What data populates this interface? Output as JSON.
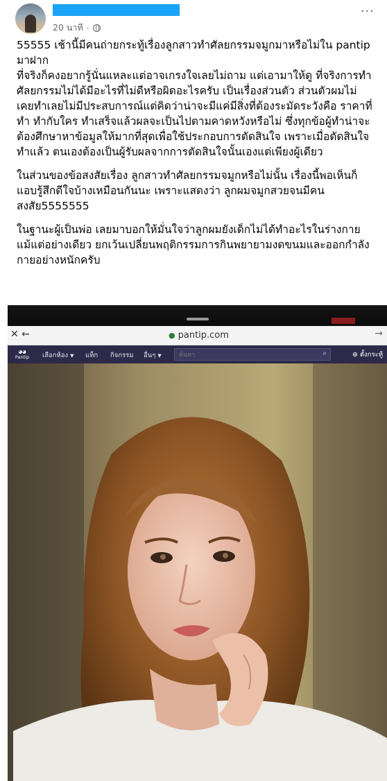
{
  "post": {
    "timestamp": "20 นาที",
    "paragraphs": [
      "55555 เช้านี้มีคนถ่ายกระทู้เรื่องลูกสาวทำศัลยกรรมจมูกมาหรือไม่ใน pantip มาฝาก\nที่จริงก็คงอยากรู้นั่นแหละแต่อาจเกรงใจเลยไม่ถาม แต่เอามาให้ดู ที่จริงการทำศัลยกรรมไม่ได้มีอะไรที่ไม่ดีหรือผิดอะไรครับ เป็นเรื่องส่วนตัว ส่วนตัวผมไม่เคยทำเลยไม่มีประสบการณ์แต่คิดว่าน่าจะมีแค่มีสิ่งที่ต้องระมัดระวังคือ ราคาที่ทำ ทำกับใคร ทำเสร็จแล้วผลจะเป็นไปตามคาดหวังหรือไม่ ซึ่งทุกข้อผู้ทำน่าจะต้องศึกษาหาข้อมูลให้มากที่สุดเพื่อใช้ประกอบการตัดสินใจ เพราะเมื่อตัดสินใจทำแล้ว ตนเองต้องเป็นผู้รับผลจากการตัดสินใจนั้นเองแต่เพียงผู้เดียว",
      "ในส่วนของข้อสงสัยเรื่อง ลูกสาวทำศัลยกรรมจมูกหรือไม่นั้น เรื่องนี้พอเห็นก็แอบรู้สึกดีใจบ้างเหมือนกันนะ เพราะแสดงว่า ลูกผมจมูกสวยจนมีคนสงสัย5555555",
      "ในฐานะผู้เป็นพ่อ เลยมาบอกให้มั่นใจว่าลูกผมยังเด็กไม่ได้ทำอะไรในร่างกายแม้แต่อย่างเดียว ยกเว้นเปลี่ยนพฤติกรรมการกินพยายามงดขนมและออกกำลังกายอย่างหนักครับ"
    ]
  },
  "screenshot": {
    "url": "pantip.com",
    "logo_text": "Pantip",
    "menu": [
      {
        "label": "เลือกห้อง",
        "has_caret": true
      },
      {
        "label": "แท็ก",
        "has_caret": false
      },
      {
        "label": "กิจกรรม",
        "has_caret": false
      },
      {
        "label": "อื่นๆ",
        "has_caret": true
      }
    ],
    "search_placeholder": "ค้นหา",
    "new_topic_label": "ตั้งกระทู้"
  }
}
